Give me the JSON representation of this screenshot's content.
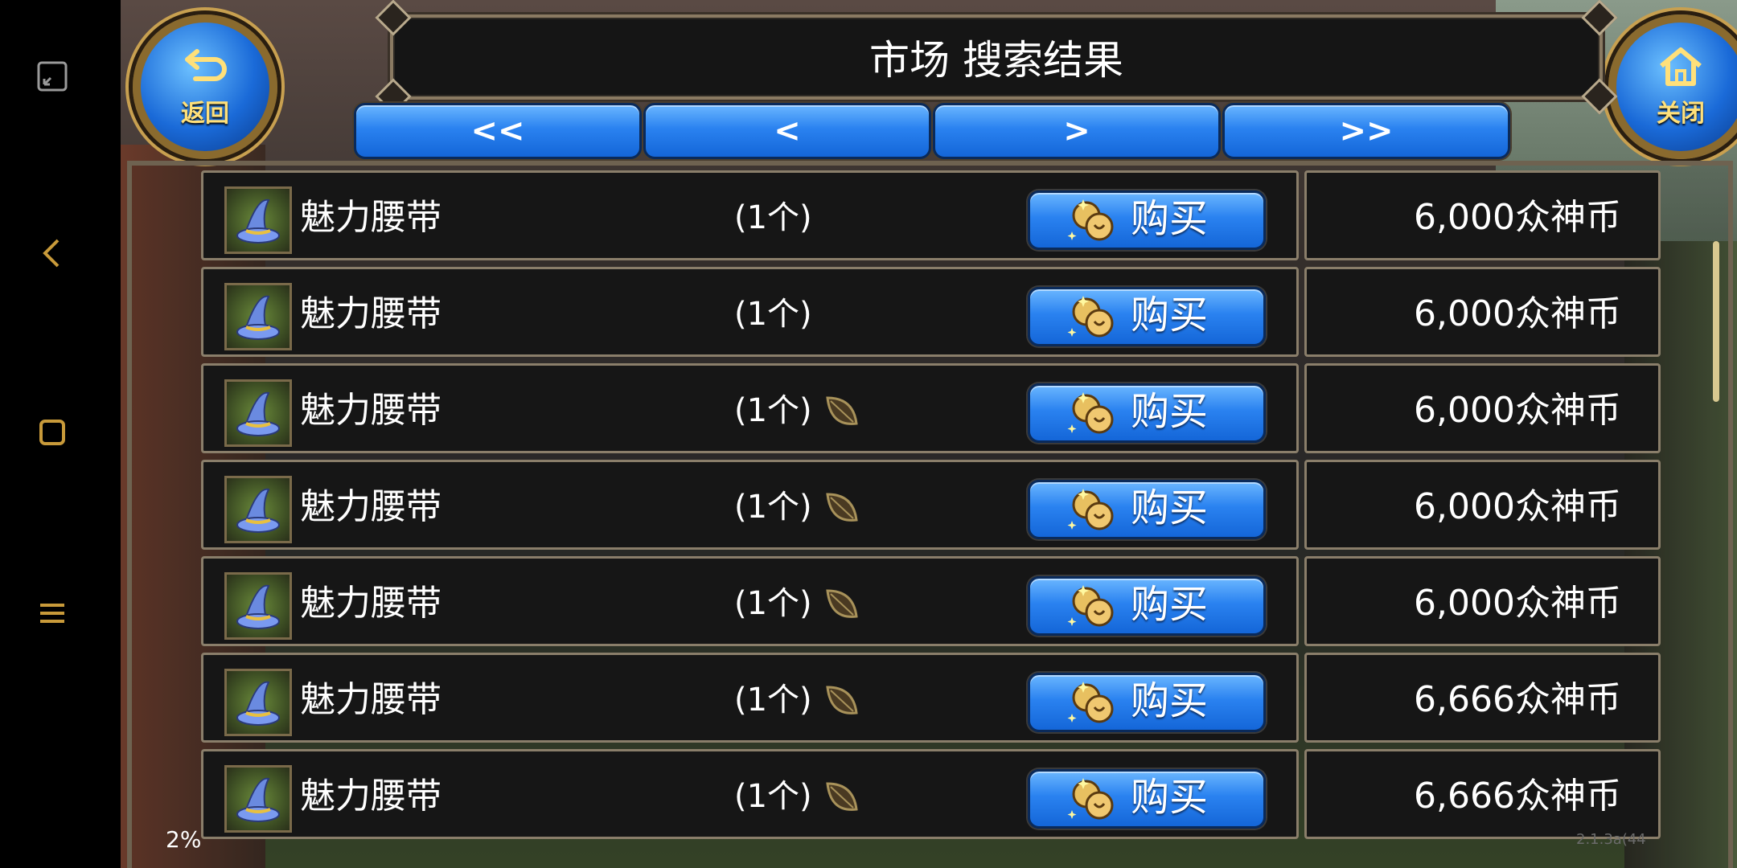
{
  "header": {
    "title": "市场 搜索结果"
  },
  "back_button": {
    "label": "返回"
  },
  "close_button": {
    "label": "关闭"
  },
  "pager": {
    "first": "<<",
    "prev": "<",
    "next": ">",
    "last": ">>"
  },
  "buy_label": "购买",
  "rows": [
    {
      "name": "魅力腰带",
      "qty": "(1个)",
      "bound": false,
      "price": "6,000众神币"
    },
    {
      "name": "魅力腰带",
      "qty": "(1个)",
      "bound": false,
      "price": "6,000众神币"
    },
    {
      "name": "魅力腰带",
      "qty": "(1个)",
      "bound": true,
      "price": "6,000众神币"
    },
    {
      "name": "魅力腰带",
      "qty": "(1个)",
      "bound": true,
      "price": "6,000众神币"
    },
    {
      "name": "魅力腰带",
      "qty": "(1个)",
      "bound": true,
      "price": "6,000众神币"
    },
    {
      "name": "魅力腰带",
      "qty": "(1个)",
      "bound": true,
      "price": "6,666众神币"
    },
    {
      "name": "魅力腰带",
      "qty": "(1个)",
      "bound": true,
      "price": "6,666众神币"
    }
  ],
  "status": {
    "percent": "2%",
    "version": "2.1.3a(44"
  },
  "system_nav": [
    "expand-icon",
    "back-icon",
    "home-icon",
    "menu-icon"
  ],
  "colors": {
    "button_blue": "#2a82f0",
    "frame": "#8a7e6a",
    "accent_gold": "#ffe07a"
  }
}
